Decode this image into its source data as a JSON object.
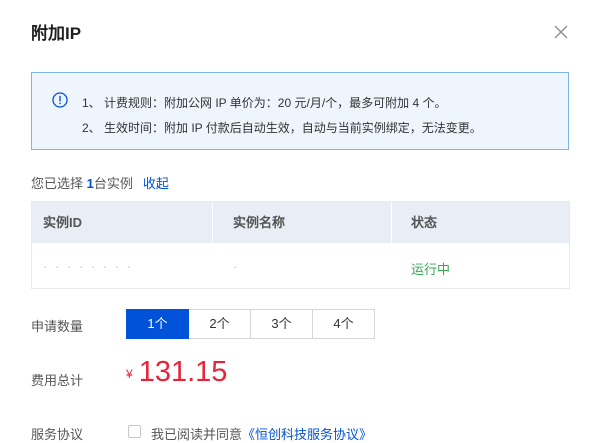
{
  "dialog": {
    "title": "附加IP"
  },
  "notice": {
    "lines": [
      "1、 计费规则：附加公网 IP 单价为：20 元/月/个，最多可附加 4 个。",
      "2、 生效时间：附加 IP 付款后自动生效，自动与当前实例绑定，无法变更。"
    ]
  },
  "selection": {
    "prefix": "您已选择 ",
    "count": "1",
    "suffix": "台实例",
    "collapse_label": "收起"
  },
  "table": {
    "columns": [
      "实例ID",
      "实例名称",
      "状态"
    ],
    "rows": [
      {
        "instance_id": "·  ·  ·  ·  ·  ·  ·  ·",
        "instance_name": "·",
        "status": "运行中"
      }
    ]
  },
  "quantity": {
    "label": "申请数量",
    "options": [
      "1个",
      "2个",
      "3个",
      "4个"
    ],
    "selected_index": 0
  },
  "cost": {
    "label": "费用总计",
    "currency": "¥",
    "amount": "131.15"
  },
  "agreement": {
    "label": "服务协议",
    "text": "我已阅读并同意",
    "link": "《恒创科技服务协议》"
  },
  "colors": {
    "accent": "#0052d9",
    "price": "#e5243b",
    "status_running": "#34a853",
    "notice_bg": "#eef5fd"
  }
}
